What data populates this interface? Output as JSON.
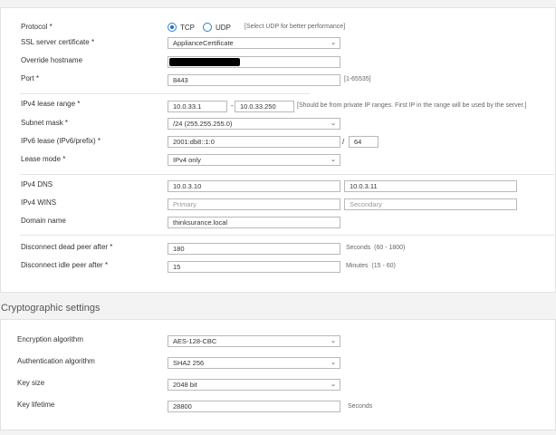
{
  "general": {
    "protocol": {
      "label": "Protocol *",
      "tcp": "TCP",
      "udp": "UDP",
      "selected": "TCP",
      "hint": "[Select UDP for better performance]"
    },
    "ssl_cert": {
      "label": "SSL server certificate *",
      "value": "ApplianceCertificate"
    },
    "override_hostname": {
      "label": "Override hostname",
      "value": ""
    },
    "port": {
      "label": "Port *",
      "value": "8443",
      "hint": "[1-65535]"
    },
    "ipv4_lease_range": {
      "label": "IPv4 lease range *",
      "start": "10.0.33.1",
      "dash": "-",
      "end": "10.0.33.250",
      "hint": "[Should be from private IP ranges. First IP in the range will be used by the server.]"
    },
    "subnet_mask": {
      "label": "Subnet mask *",
      "value": "/24 (255.255.255.0)"
    },
    "ipv6_lease": {
      "label": "IPv6 lease (IPv6/prefix) *",
      "value": "2001:db8::1:0",
      "slash": "/",
      "prefix": "64"
    },
    "lease_mode": {
      "label": "Lease mode *",
      "value": "IPv4 only"
    },
    "ipv4_dns": {
      "label": "IPv4 DNS",
      "primary": "10.0.3.10",
      "secondary": "10.0.3.11"
    },
    "ipv4_wins": {
      "label": "IPv4 WINS",
      "primary_placeholder": "Primary",
      "secondary_placeholder": "Secondary"
    },
    "domain_name": {
      "label": "Domain name",
      "value": "thinksurance.local"
    },
    "dead_peer": {
      "label": "Disconnect dead peer after *",
      "value": "180",
      "hint": "Seconds  (60 - 1800)"
    },
    "idle_peer": {
      "label": "Disconnect idle peer after *",
      "value": "15",
      "hint": "Minutes  (15 - 60)"
    }
  },
  "crypto": {
    "title": "Cryptographic settings",
    "encryption": {
      "label": "Encryption algorithm",
      "value": "AES-128-CBC"
    },
    "authentication": {
      "label": "Authentication algorithm",
      "value": "SHA2 256"
    },
    "key_size": {
      "label": "Key size",
      "value": "2048 bit"
    },
    "key_lifetime": {
      "label": "Key lifetime",
      "value": "28800",
      "unit": "Seconds"
    }
  },
  "icons": {
    "dropdown": "chevron-down-icon",
    "radio": "radio-button"
  },
  "colors": {
    "accent": "#1d6fc0",
    "field_border": "#b9b9b9",
    "background": "#f3f3f3"
  }
}
